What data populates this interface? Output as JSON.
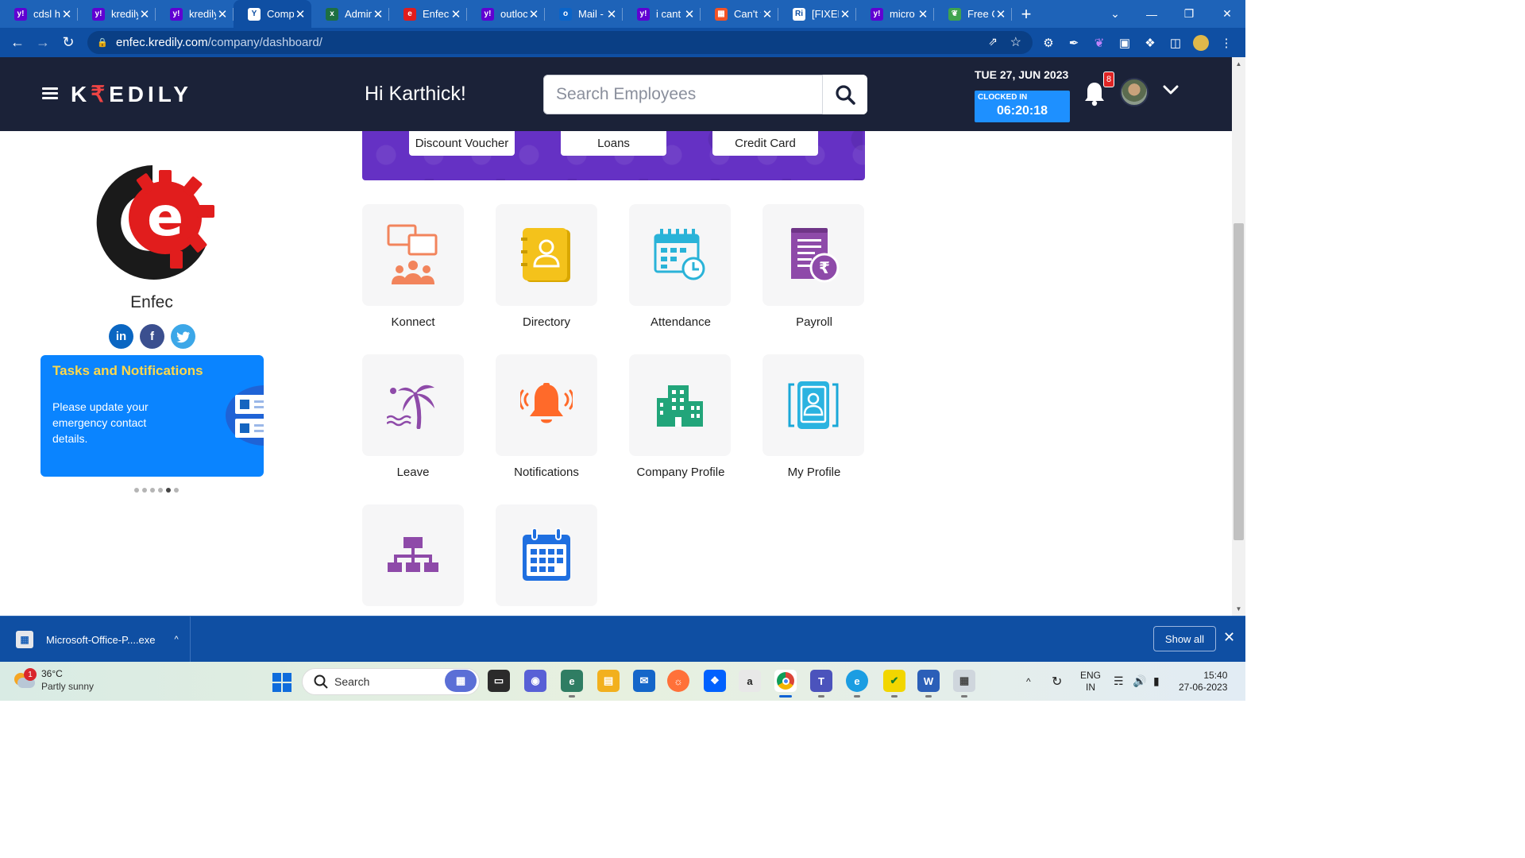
{
  "browser": {
    "tabs": [
      {
        "title": "cdsl h",
        "favicon": "yahoo-icon",
        "active": false
      },
      {
        "title": "kredily",
        "favicon": "yahoo-icon",
        "active": false
      },
      {
        "title": "kredily",
        "favicon": "yahoo-icon",
        "active": false
      },
      {
        "title": "Comp",
        "favicon": "ycombinator-icon",
        "active": true
      },
      {
        "title": "Admin",
        "favicon": "excel-icon",
        "active": false
      },
      {
        "title": "Enfec",
        "favicon": "enfec-icon",
        "active": false
      },
      {
        "title": "outloc",
        "favicon": "yahoo-icon",
        "active": false
      },
      {
        "title": "Mail -",
        "favicon": "outlook-icon",
        "active": false
      },
      {
        "title": "i cant",
        "favicon": "yahoo-icon",
        "active": false
      },
      {
        "title": "Can't t",
        "favicon": "microsoft-icon",
        "active": false
      },
      {
        "title": "[FIXED",
        "favicon": "ri-icon",
        "active": false
      },
      {
        "title": "micro",
        "favicon": "yahoo-icon",
        "active": false
      },
      {
        "title": "Free C",
        "favicon": "leaf-icon",
        "active": false
      }
    ],
    "url_host": "enfec.kredily.com",
    "url_path": "/company/dashboard/"
  },
  "header": {
    "brand": "KREDILY",
    "greeting": "Hi Karthick!",
    "search_placeholder": "Search Employees",
    "date": "TUE 27, JUN 2023",
    "clocked_label": "CLOCKED IN",
    "clocked_time": "06:20:18",
    "notification_count": "8"
  },
  "profile": {
    "company_name": "Enfec",
    "social": [
      "linkedin-icon",
      "facebook-icon",
      "twitter-icon"
    ],
    "tasks_title": "Tasks and Notifications",
    "tasks_message": "Please update your emergency contact details.",
    "carousel_dots": 6,
    "carousel_active": 4
  },
  "banner": {
    "buttons": [
      "Discount Voucher",
      "Loans",
      "Credit Card"
    ]
  },
  "modules": [
    {
      "label": "Konnect",
      "icon": "chat-group-icon"
    },
    {
      "label": "Directory",
      "icon": "contact-book-icon"
    },
    {
      "label": "Attendance",
      "icon": "calendar-clock-icon"
    },
    {
      "label": "Payroll",
      "icon": "rupee-document-icon"
    },
    {
      "label": "Leave",
      "icon": "palm-tree-icon"
    },
    {
      "label": "Notifications",
      "icon": "bell-icon"
    },
    {
      "label": "Company Profile",
      "icon": "building-icon"
    },
    {
      "label": "My Profile",
      "icon": "id-card-icon"
    },
    {
      "label": "",
      "icon": "org-chart-icon"
    },
    {
      "label": "",
      "icon": "calendar-icon"
    }
  ],
  "downloads": {
    "file": "Microsoft-Office-P....exe",
    "show_all": "Show all"
  },
  "taskbar": {
    "temperature": "36°C",
    "weather": "Partly sunny",
    "weather_badge": "1",
    "search": "Search",
    "lang_top": "ENG",
    "lang_bottom": "IN",
    "time": "15:40",
    "date": "27-06-2023"
  },
  "colors": {
    "header_bg": "#1b2238",
    "browser_tab_strip": "#1e63b8",
    "browser_toolbar": "#0f4fa3",
    "banner": "#6531c4",
    "tasks_card": "#0a84ff",
    "clock_box": "#1e90ff",
    "tasks_title": "#ffd84a"
  }
}
